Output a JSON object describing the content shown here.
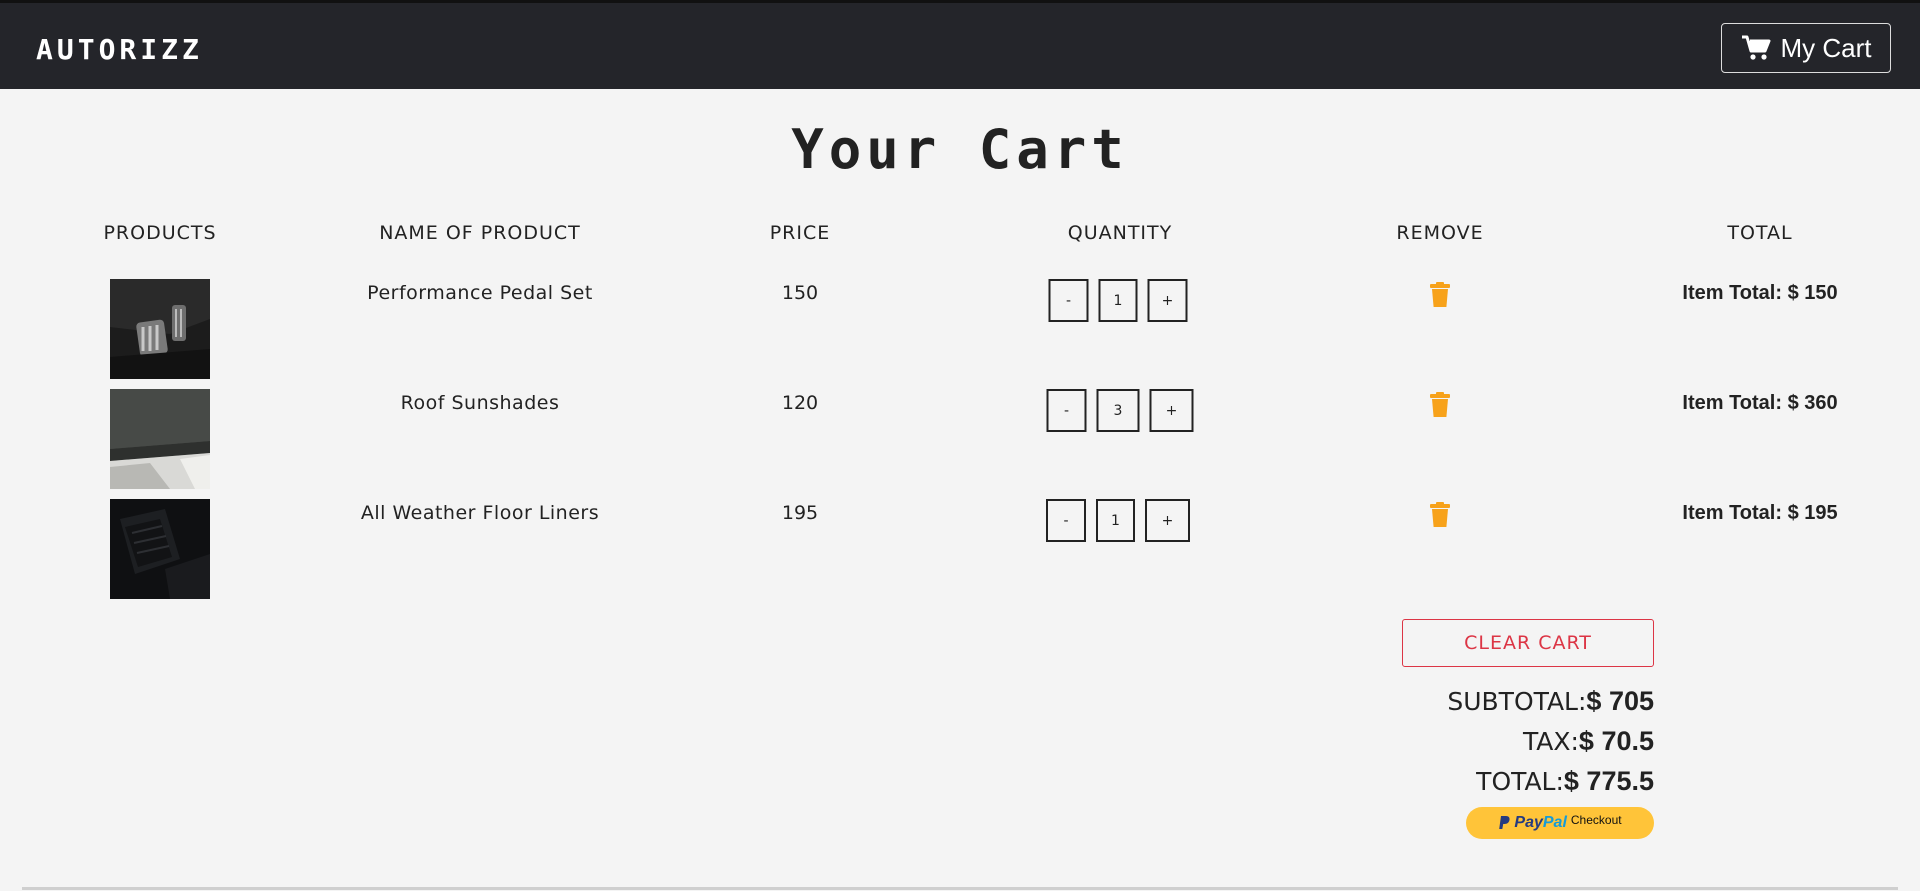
{
  "nav": {
    "brand": "AUTORIZZ",
    "cart_label": "My Cart",
    "cart_icon": "shopping-cart-icon"
  },
  "page_title": "Your Cart",
  "columns": {
    "products": "PRODUCTS",
    "name": "NAME OF PRODUCT",
    "price": "PRICE",
    "quantity": "QUANTITY",
    "remove": "REMOVE",
    "total": "TOTAL"
  },
  "items": [
    {
      "name": "Performance Pedal Set",
      "price": "150",
      "quantity": "1",
      "total": "Item Total: $ 150"
    },
    {
      "name": "Roof Sunshades",
      "price": "120",
      "quantity": "3",
      "total": "Item Total: $ 360"
    },
    {
      "name": "All Weather Floor Liners",
      "price": "195",
      "quantity": "1",
      "total": "Item Total: $ 195"
    }
  ],
  "qty_controls": {
    "minus": "-",
    "plus": "+"
  },
  "clear_cart": "CLEAR CART",
  "summary": {
    "subtotal_label": "SUBTOTAL:",
    "subtotal_value": "$ 705",
    "tax_label": "TAX:",
    "tax_value": "$ 70.5",
    "total_label": "TOTAL:",
    "total_value": "$ 775.5"
  },
  "paypal": {
    "pay": "Pay",
    "pal": "Pal",
    "checkout": "Checkout"
  },
  "colors": {
    "navbar": "#24252a",
    "trash_icon": "#f7a21b",
    "clear_cart": "#dc3545",
    "paypal_button": "#ffc439"
  }
}
